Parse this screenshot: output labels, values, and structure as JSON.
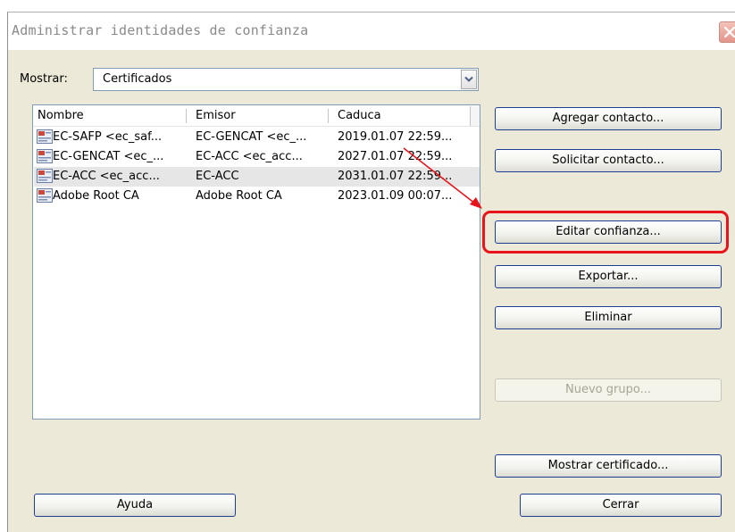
{
  "dialog": {
    "title": "Administrar identidades de confianza",
    "show_label": "Mostrar:",
    "show_value": "Certificados"
  },
  "list": {
    "columns": [
      "Nombre",
      "Emisor",
      "Caduca"
    ],
    "rows": [
      {
        "name": "EC-SAFP <ec_saf...",
        "issuer": "EC-GENCAT <ec_...",
        "expires": "2019.01.07 22:59...",
        "icon": "certificate-icon"
      },
      {
        "name": "EC-GENCAT <ec_...",
        "issuer": "EC-ACC <ec_acc...",
        "expires": "2027.01.07 22:59...",
        "icon": "certificate-icon"
      },
      {
        "name": "EC-ACC <ec_acc...",
        "issuer": "EC-ACC",
        "expires": "2031.01.07 22:59...",
        "icon": "certificate-icon",
        "selected": true
      },
      {
        "name": "Adobe Root CA",
        "issuer": "Adobe Root CA",
        "expires": "2023.01.09 00:07...",
        "icon": "certificate-icon"
      }
    ]
  },
  "buttons": {
    "add_contact": "Agregar contacto...",
    "request_contact": "Solicitar contacto...",
    "edit_trust": "Editar confianza...",
    "export": "Exportar...",
    "delete": "Eliminar",
    "new_group": "Nuevo grupo...",
    "show_certificate": "Mostrar certificado...",
    "help": "Ayuda",
    "close": "Cerrar"
  },
  "colors": {
    "annotation": "#e8141c",
    "button_border": "#1c3f94"
  }
}
